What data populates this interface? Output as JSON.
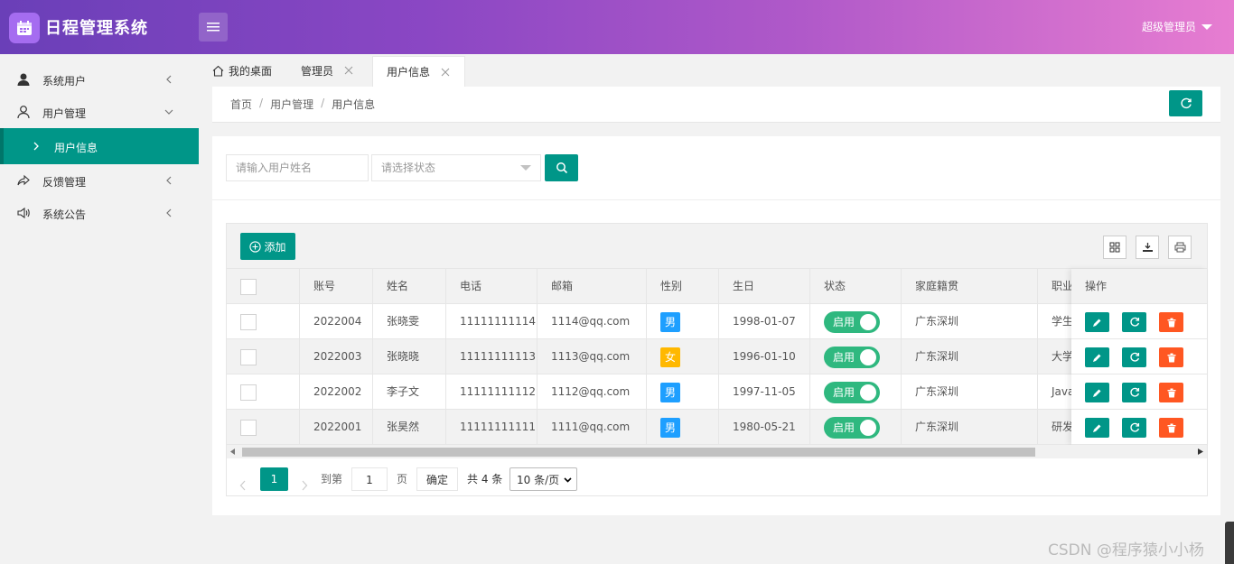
{
  "app": {
    "title": "日程管理系统",
    "user_menu": "超级管理员"
  },
  "sidebar": {
    "items": [
      {
        "label": "系统用户",
        "icon": "user-filled-icon"
      },
      {
        "label": "用户管理",
        "icon": "user-outline-icon"
      },
      {
        "label": "用户信息",
        "icon": "chevron-right-icon"
      },
      {
        "label": "反馈管理",
        "icon": "share-icon"
      },
      {
        "label": "系统公告",
        "icon": "speaker-icon"
      }
    ]
  },
  "tabs": [
    {
      "label": "我的桌面"
    },
    {
      "label": "管理员"
    },
    {
      "label": "用户信息"
    }
  ],
  "breadcrumb": [
    "首页",
    "用户管理",
    "用户信息"
  ],
  "breadcrumb_sep": "/",
  "search": {
    "name_placeholder": "请输入用户姓名",
    "status_placeholder": "请选择状态"
  },
  "toolbar": {
    "add_label": "添加"
  },
  "table": {
    "columns": [
      "账号",
      "姓名",
      "电话",
      "邮箱",
      "性别",
      "生日",
      "状态",
      "家庭籍贯",
      "职业",
      "操作"
    ],
    "rows": [
      {
        "account": "2022004",
        "name": "张晓雯",
        "phone": "11111111114",
        "email": "1114@qq.com",
        "gender": "男",
        "gender_color": "#1e9fff",
        "birthday": "1998-01-07",
        "status": "启用",
        "hometown": "广东深圳",
        "job": "学生"
      },
      {
        "account": "2022003",
        "name": "张晓晓",
        "phone": "11111111113",
        "email": "1113@qq.com",
        "gender": "女",
        "gender_color": "#ffb800",
        "birthday": "1996-01-10",
        "status": "启用",
        "hometown": "广东深圳",
        "job": "大学"
      },
      {
        "account": "2022002",
        "name": "李子文",
        "phone": "11111111112",
        "email": "1112@qq.com",
        "gender": "男",
        "gender_color": "#1e9fff",
        "birthday": "1997-11-05",
        "status": "启用",
        "hometown": "广东深圳",
        "job": "Java"
      },
      {
        "account": "2022001",
        "name": "张昊然",
        "phone": "11111111111",
        "email": "1111@qq.com",
        "gender": "男",
        "gender_color": "#1e9fff",
        "birthday": "1980-05-21",
        "status": "启用",
        "hometown": "广东深圳",
        "job": "研发"
      }
    ]
  },
  "pager": {
    "current": "1",
    "goto_label": "到第",
    "goto_value": "1",
    "page_unit": "页",
    "confirm": "确定",
    "total": "共 4 条",
    "page_size": "10 条/页"
  },
  "watermark": "CSDN @程序猿小小杨",
  "colors": {
    "accent": "#009688",
    "toggle_on": "#2fb87f",
    "delete": "#ff5722"
  }
}
